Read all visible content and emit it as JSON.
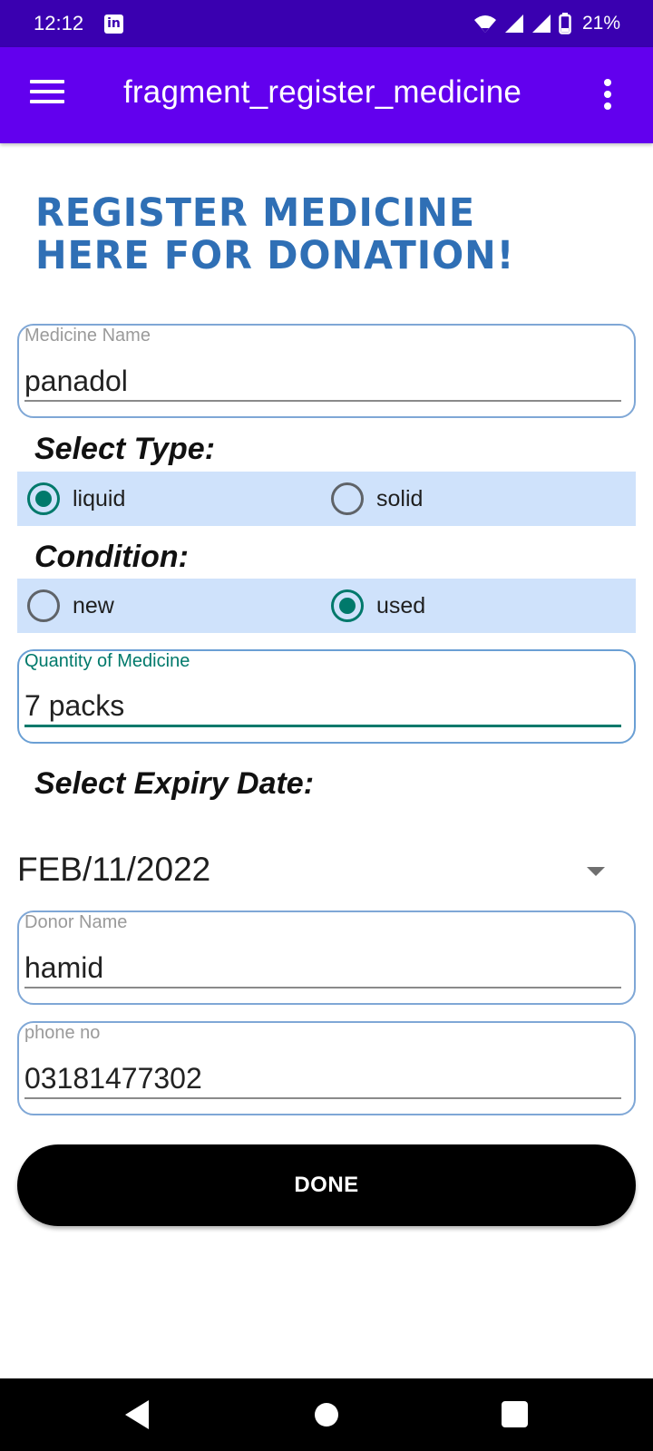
{
  "status_bar": {
    "time": "12:12",
    "notification_icon": "linkedin-icon",
    "battery": "21%"
  },
  "app_bar": {
    "title": "fragment_register_medicine"
  },
  "heading": "Register Medicine Here For Donation!",
  "fields": {
    "medicine_name": {
      "label": "Medicine Name",
      "value": "panadol"
    },
    "quantity": {
      "label": "Quantity of Medicine",
      "value": "7 packs"
    },
    "donor_name": {
      "label": "Donor Name",
      "value": "hamid"
    },
    "phone": {
      "label": "phone no",
      "value": "03181477302"
    }
  },
  "type_section": {
    "label": "Select Type:",
    "options": [
      {
        "label": "liquid",
        "checked": true
      },
      {
        "label": "solid",
        "checked": false
      }
    ]
  },
  "condition_section": {
    "label": "Condition:",
    "options": [
      {
        "label": "new",
        "checked": false
      },
      {
        "label": "used",
        "checked": true
      }
    ]
  },
  "expiry_section": {
    "label": "Select Expiry Date:",
    "value": "FEB/11/2022"
  },
  "done_button": "DONE",
  "colors": {
    "status_bar": "#3a00b0",
    "app_bar": "#6200ee",
    "heading": "#2f6fb5",
    "radio_accent": "#00796b",
    "radio_group_bg": "#cfe2fb",
    "button": "#000000"
  }
}
